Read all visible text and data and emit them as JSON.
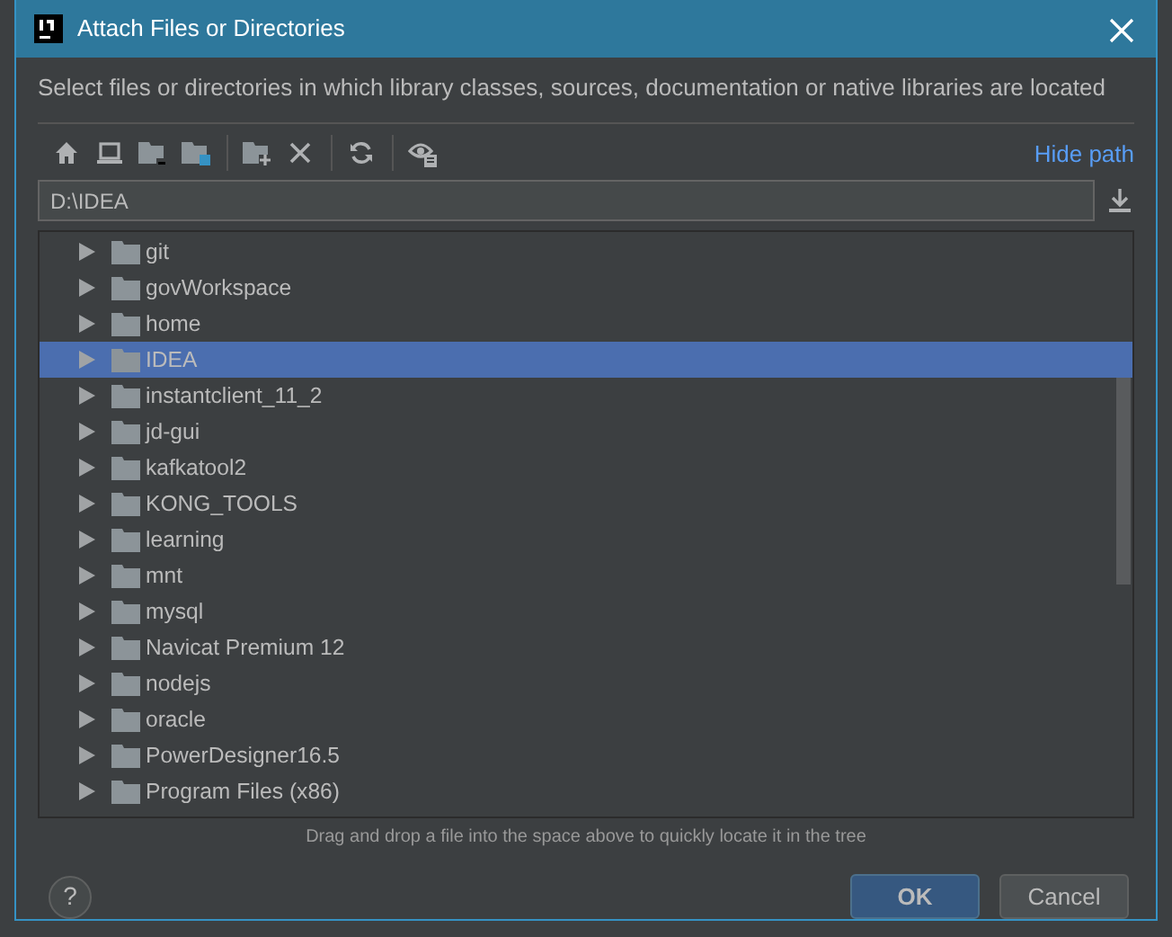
{
  "window": {
    "title": "Attach Files or Directories"
  },
  "description": "Select files or directories in which library classes, sources, documentation or native libraries are located",
  "toolbar": {
    "hide_path": "Hide path"
  },
  "path": {
    "value": "D:\\IDEA"
  },
  "tree": [
    {
      "label": "git",
      "selected": false
    },
    {
      "label": "govWorkspace",
      "selected": false
    },
    {
      "label": "home",
      "selected": false
    },
    {
      "label": "IDEA",
      "selected": true
    },
    {
      "label": "instantclient_11_2",
      "selected": false
    },
    {
      "label": "jd-gui",
      "selected": false
    },
    {
      "label": "kafkatool2",
      "selected": false
    },
    {
      "label": "KONG_TOOLS",
      "selected": false
    },
    {
      "label": "learning",
      "selected": false
    },
    {
      "label": "mnt",
      "selected": false
    },
    {
      "label": "mysql",
      "selected": false
    },
    {
      "label": "Navicat Premium 12",
      "selected": false
    },
    {
      "label": "nodejs",
      "selected": false
    },
    {
      "label": "oracle",
      "selected": false
    },
    {
      "label": "PowerDesigner16.5",
      "selected": false
    },
    {
      "label": "Program Files (x86)",
      "selected": false
    }
  ],
  "hint": "Drag and drop a file into the space above to quickly locate it in the tree",
  "buttons": {
    "help": "?",
    "ok": "OK",
    "cancel": "Cancel"
  }
}
